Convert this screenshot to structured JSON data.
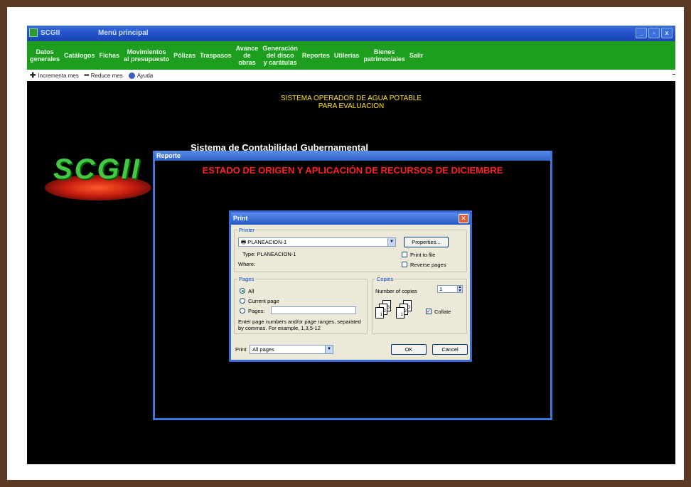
{
  "window": {
    "app_name": "SCGII",
    "title": "Menú principal",
    "controls": [
      "_",
      "▫",
      "x"
    ]
  },
  "menu": [
    {
      "label": "Datos\ngenerales"
    },
    {
      "label": "Catálogos"
    },
    {
      "label": "Fichas"
    },
    {
      "label": "Movimientos\nal presupuesto"
    },
    {
      "label": "Pólizas"
    },
    {
      "label": "Traspasos"
    },
    {
      "label": "Avance\nde\nobras"
    },
    {
      "label": "Generación\ndel disco\ny carátulas"
    },
    {
      "label": "Reportes"
    },
    {
      "label": "Utilerías"
    },
    {
      "label": "Bienes\npatrimoniales"
    },
    {
      "label": "Salir"
    }
  ],
  "toolbar": {
    "increment": "Incrementa mes",
    "decrement": "Reduce mes",
    "help": "Ayuda"
  },
  "main": {
    "system_line1": "SISTEMA OPERADOR DE AGUA POTABLE",
    "system_line2": "PARA EVALUACION",
    "contabilidad": "Sistema de Contabilidad Gubernamental",
    "logo_text": "SCGII"
  },
  "report_window": {
    "title": "Reporte",
    "heading": "ESTADO DE ORIGEN Y APLICACIÓN DE RECURSOS DE DICIEMBRE"
  },
  "print_dialog": {
    "title": "Print",
    "printer_group": "Printer",
    "printer_name": "PLANEACION-1",
    "properties_button": "Properties...",
    "type_label": "Type:",
    "type_value": "PLANEACION-1",
    "where_label": "Where:",
    "print_to_file": "Print to file",
    "reverse_pages": "Reverse pages",
    "pages_group": "Pages",
    "all": "All",
    "current_page": "Current page",
    "pages": "Pages:",
    "pages_help": "Enter page numbers and/or page ranges, separated by commas. For example, 1,3,5-12",
    "copies_group": "Copies",
    "number_of_copies": "Number of copies",
    "copies_value": "1",
    "collate": "Collate",
    "print_label": "Print",
    "print_select": "All pages",
    "ok_button": "OK",
    "cancel_button": "Cancel"
  }
}
